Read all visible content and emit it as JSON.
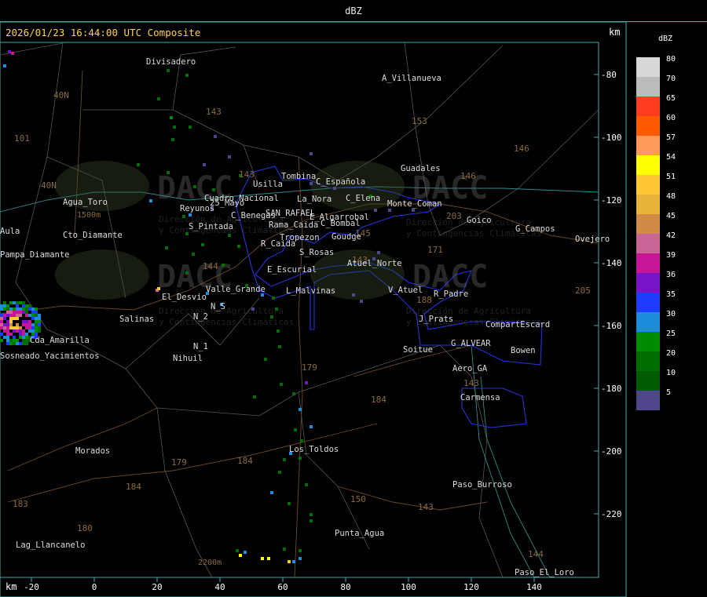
{
  "header": {
    "title": "dBZ"
  },
  "map": {
    "timestamp": "2026/01/23 16:44:00 UTC Composite",
    "unit_top": "km",
    "unit_bottom": "km",
    "x_ticks": [
      "-20",
      "0",
      "20",
      "40",
      "60",
      "80",
      "100",
      "120",
      "140"
    ],
    "y_ticks": [
      "-80",
      "-100",
      "-120",
      "-140",
      "-160",
      "-180",
      "-200",
      "-220"
    ],
    "watermark": {
      "brand": "DACC",
      "line1": "Dirección de Agricultura",
      "line2": "y Contingencias Climáticas"
    },
    "places": [
      {
        "name": "Divisadero"
      },
      {
        "name": "A_Villanueva"
      },
      {
        "name": "Tombina"
      },
      {
        "name": "Usilla"
      },
      {
        "name": "C_Española"
      },
      {
        "name": "C_Elena"
      },
      {
        "name": "Guadales"
      },
      {
        "name": "La_Nora"
      },
      {
        "name": "SAN_RAFAEL"
      },
      {
        "name": "C_Benegas"
      },
      {
        "name": "E_Algarrobal"
      },
      {
        "name": "C_Bombal"
      },
      {
        "name": "Rama_Caida"
      },
      {
        "name": "Tropezon"
      },
      {
        "name": "Goudge"
      },
      {
        "name": "R_Caida"
      },
      {
        "name": "S_Rosas"
      },
      {
        "name": "Atuel_Norte"
      },
      {
        "name": "E_Escurial"
      },
      {
        "name": "Monte_Coman"
      },
      {
        "name": "Goico"
      },
      {
        "name": "G_Campos"
      },
      {
        "name": "Ovejero"
      },
      {
        "name": "Agua_Toro"
      },
      {
        "name": "Cto_Diamante"
      },
      {
        "name": "Pampa_Diamante"
      },
      {
        "name": "Cuadro_Nacional"
      },
      {
        "name": "Reyunos"
      },
      {
        "name": "25_Mayo"
      },
      {
        "name": "S_Pintada"
      },
      {
        "name": "El_Desvio"
      },
      {
        "name": "Valle_Grande"
      },
      {
        "name": "L_Malvinas"
      },
      {
        "name": "V_Atuel"
      },
      {
        "name": "R_Padre"
      },
      {
        "name": "J_Prats"
      },
      {
        "name": "CompartEscard"
      },
      {
        "name": "Salinas"
      },
      {
        "name": "N_S"
      },
      {
        "name": "N_2"
      },
      {
        "name": "N_1"
      },
      {
        "name": "Nihuil"
      },
      {
        "name": "Soitue"
      },
      {
        "name": "G_ALVEAR"
      },
      {
        "name": "Bowen"
      },
      {
        "name": "Aero_GA"
      },
      {
        "name": "Carmensa"
      },
      {
        "name": "Cda_Amarilla"
      },
      {
        "name": "Sosneado_Yacimientos"
      },
      {
        "name": "Morados"
      },
      {
        "name": "Los_Toldos"
      },
      {
        "name": "Paso_Burroso"
      },
      {
        "name": "Punta_Agua"
      },
      {
        "name": "Lag_Llancanelo"
      },
      {
        "name": "Paso_El_Loro"
      },
      {
        "name": "Aula"
      }
    ],
    "route_labels": [
      "40N",
      "40N",
      "101",
      "143",
      "153",
      "143",
      "146",
      "146",
      "203",
      "144",
      "171",
      "145",
      "143",
      "188",
      "205",
      "179",
      "184",
      "184",
      "184",
      "183",
      "180",
      "179",
      "150",
      "143",
      "143",
      "144"
    ],
    "elevation_labels": [
      "1500m",
      "2200m"
    ]
  },
  "legend": {
    "title": "dBZ",
    "entries": [
      {
        "value": "80",
        "color": "#d8d8d8"
      },
      {
        "value": "70",
        "color": "#bcbcbc"
      },
      {
        "value": "65",
        "color": "#ff3c1e"
      },
      {
        "value": "60",
        "color": "#ff5a00"
      },
      {
        "value": "57",
        "color": "#ff9a5a"
      },
      {
        "value": "54",
        "color": "#ffff00"
      },
      {
        "value": "51",
        "color": "#ffc832"
      },
      {
        "value": "48",
        "color": "#e8b43c"
      },
      {
        "value": "45",
        "color": "#d28b46"
      },
      {
        "value": "42",
        "color": "#c86496"
      },
      {
        "value": "39",
        "color": "#c81496"
      },
      {
        "value": "36",
        "color": "#7814c8"
      },
      {
        "value": "35",
        "color": "#1e3cff"
      },
      {
        "value": "30",
        "color": "#1e8cdc"
      },
      {
        "value": "25",
        "color": "#008c00"
      },
      {
        "value": "20",
        "color": "#006e00"
      },
      {
        "value": "10",
        "color": "#005a00"
      },
      {
        "value": "5",
        "color": "#50468c"
      }
    ]
  }
}
